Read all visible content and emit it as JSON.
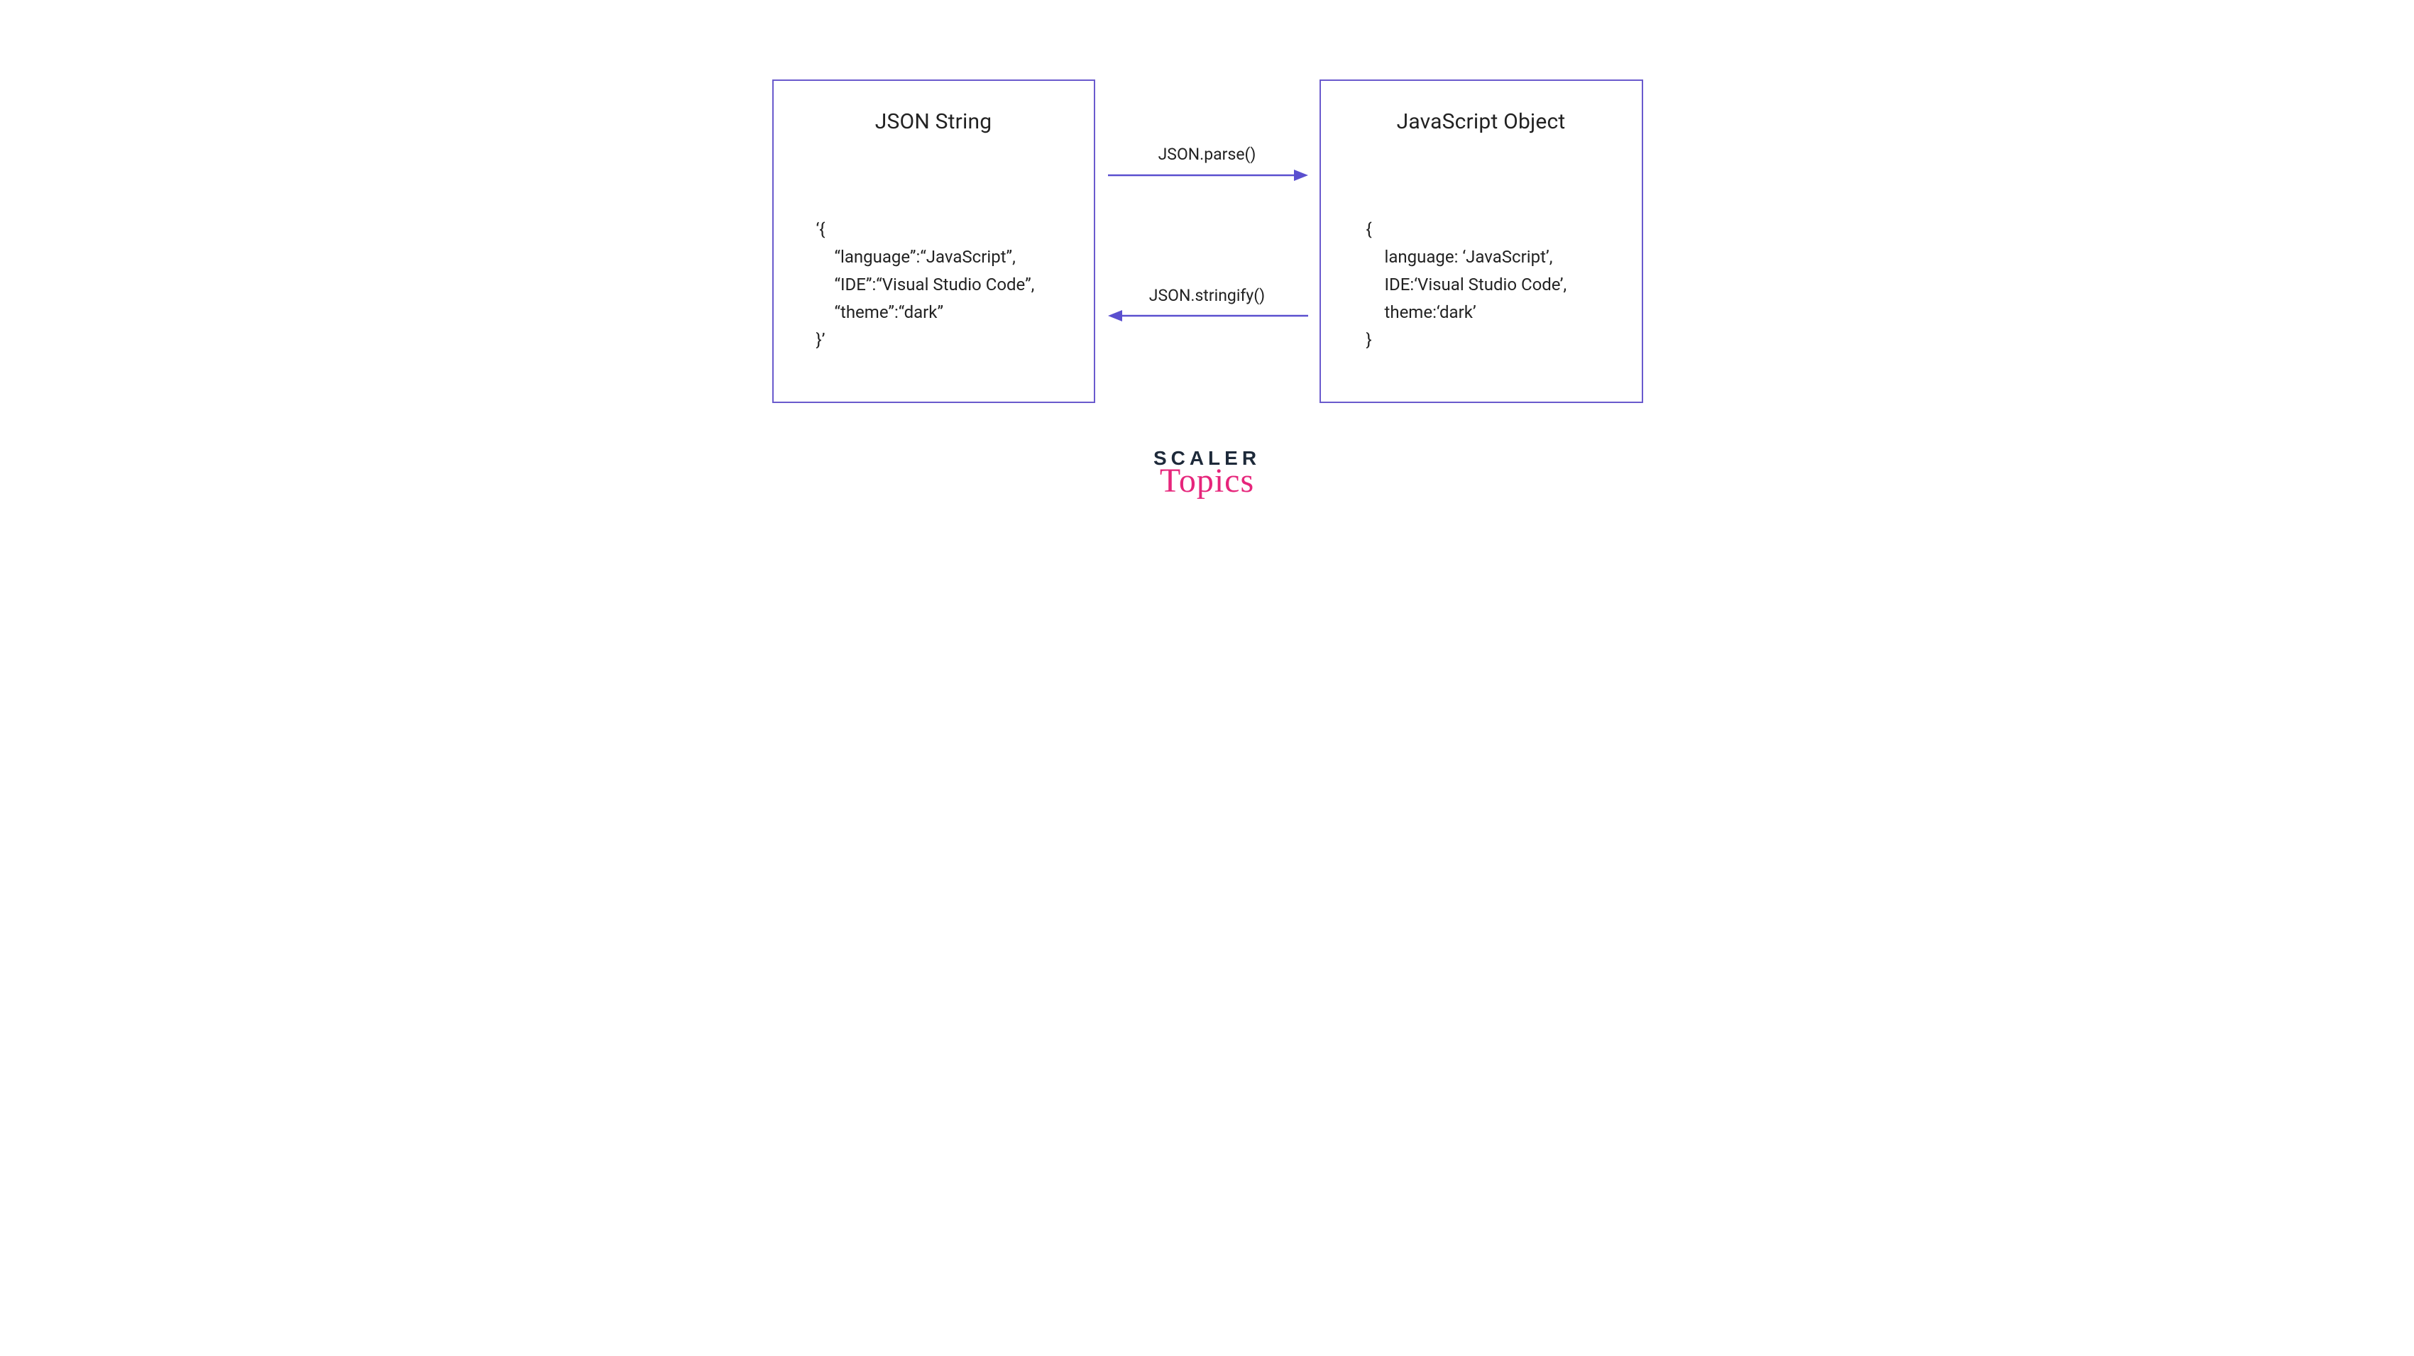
{
  "left_box": {
    "title": "JSON String",
    "code": {
      "open": "‘{",
      "line1": "“language”:“JavaScript”,",
      "line2": "“IDE”:“Visual Studio Code”,",
      "line3": "“theme”:“dark”",
      "close": "}’"
    }
  },
  "right_box": {
    "title": "JavaScript Object",
    "code": {
      "open": "{",
      "line1": "language: ‘JavaScript’,",
      "line2": "IDE:‘Visual Studio Code’,",
      "line3": "theme:‘dark’",
      "close": "}"
    }
  },
  "arrows": {
    "top_label": "JSON.parse()",
    "bottom_label": "JSON.stringify()"
  },
  "logo": {
    "main": "SCALER",
    "sub": "Topics"
  },
  "colors": {
    "border": "#6a5acd",
    "arrow": "#5a4fcf",
    "logo_sub": "#e6257b",
    "logo_main": "#1e2a3a"
  }
}
